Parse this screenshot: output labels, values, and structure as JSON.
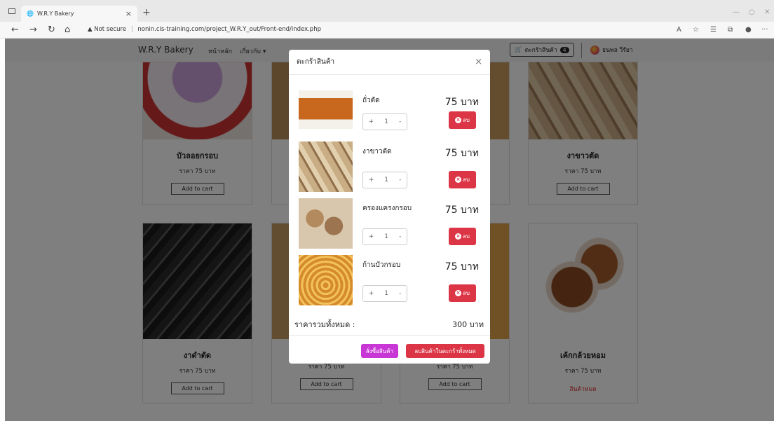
{
  "browser": {
    "tab_title": "W.R.Y Bakery",
    "new_tab": "+",
    "not_secure": "Not secure",
    "url": "nonin.cis-training.com/project_W.R.Y_out/Front-end/index.php"
  },
  "navbar": {
    "brand": "W.R.Y Bakery",
    "home": "หน้าหลัก",
    "about": "เกี่ยวกับ",
    "cart_label": "ตะกร้าสินค้า",
    "cart_count": "4",
    "user_name": "ธนพล วีรัยา"
  },
  "products": [
    {
      "name": "บัวลอยกรอบ",
      "price": "ราคา 75 บาท",
      "button": "Add to cart"
    },
    {
      "name": "งาขาวตัด",
      "price": "ราคา 75 บาท",
      "button": "Add to cart"
    },
    {
      "name": "งาดำตัด",
      "price": "ราคา 75 บาท",
      "button": "Add to cart"
    },
    {
      "name": "",
      "price": "ราคา 75 บาท",
      "button": "Add to cart"
    },
    {
      "name": "",
      "price": "ราคา 75 บาท",
      "button": "Add to cart"
    },
    {
      "name": "เค้กกล้วยหอม",
      "price": "ราคา 75 บาท",
      "sold_out": "สินค้าหมด"
    }
  ],
  "cart_modal": {
    "title": "ตะกร้าสินค้า",
    "close": "×",
    "items": [
      {
        "name": "ถั่วตัด",
        "price": "75 บาท",
        "qty": "1",
        "delete": "ลบ"
      },
      {
        "name": "งาขาวตัด",
        "price": "75 บาท",
        "qty": "1",
        "delete": "ลบ"
      },
      {
        "name": "ครองแครงกรอบ",
        "price": "75 บาท",
        "qty": "1",
        "delete": "ลบ"
      },
      {
        "name": "ก้านบัวกรอบ",
        "price": "75 บาท",
        "qty": "1",
        "delete": "ลบ"
      }
    ],
    "total_label": "ราคารวมทั้งหมด :",
    "total_value": "300 บาท",
    "order_button": "สั่งซื้อสินค้า",
    "clear_button": "ลบสินค้าในตะกร้าทั้งหมด"
  }
}
